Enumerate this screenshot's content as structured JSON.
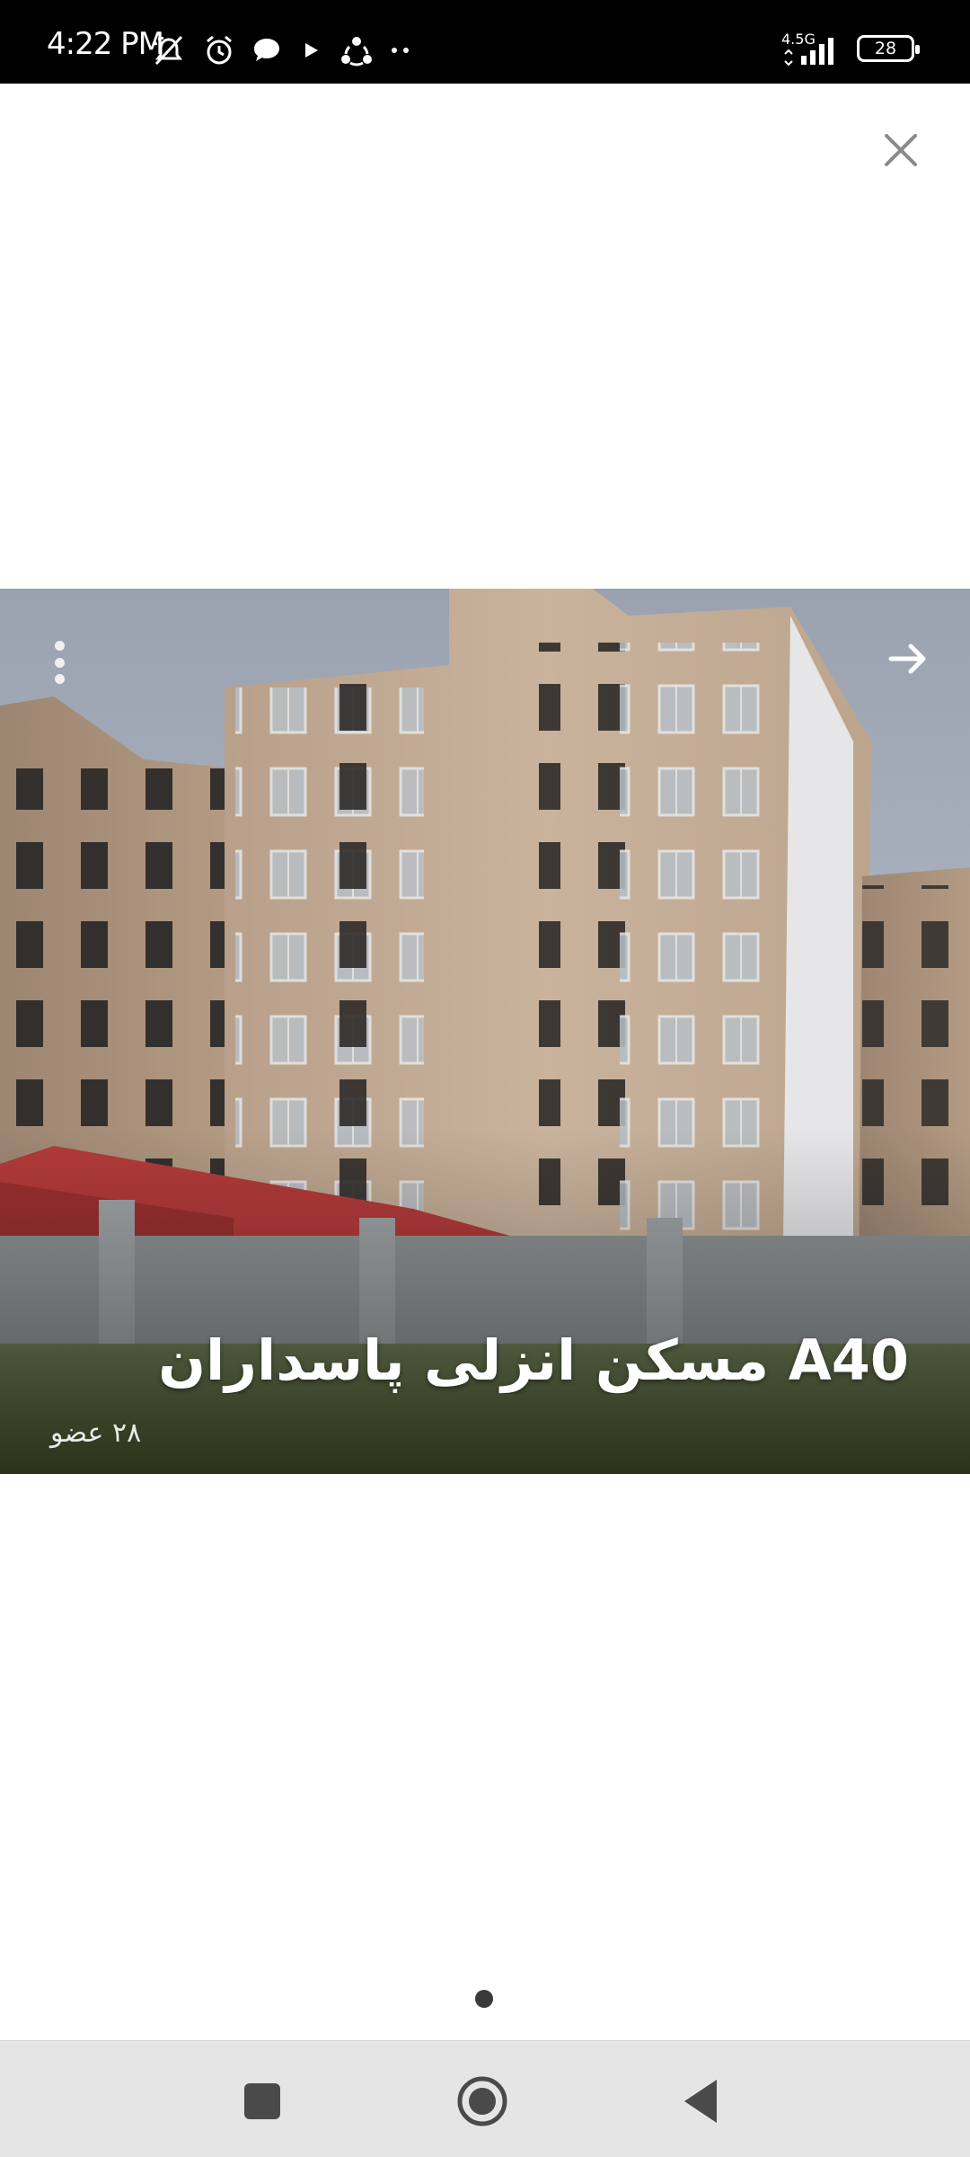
{
  "status_bar": {
    "time": "4:22 PM",
    "network": "4.5G",
    "battery": "28",
    "icons": [
      "silent-icon",
      "alarm-icon",
      "message-icon",
      "play-icon",
      "share-icon",
      "more-dots-icon",
      "signal-icon",
      "battery-icon"
    ]
  },
  "dialog": {
    "close_icon": "close-icon"
  },
  "card": {
    "title": "A40 مسکن انزلی پاسداران",
    "members": "۲۸ عضو",
    "menu_icon": "more-vert-icon",
    "next_icon": "arrow-right-icon"
  },
  "pager": {
    "count": 1,
    "active": 1
  },
  "nav_bar": {
    "icons": [
      "recents-icon",
      "home-icon",
      "back-icon"
    ]
  },
  "colors": {
    "status_bar": "#000000",
    "nav_bar": "#e5e5e5",
    "close_icon": "#8a8a8a",
    "page_dot": "#3a3a3a",
    "nav_icon": "#4a4a4a"
  }
}
